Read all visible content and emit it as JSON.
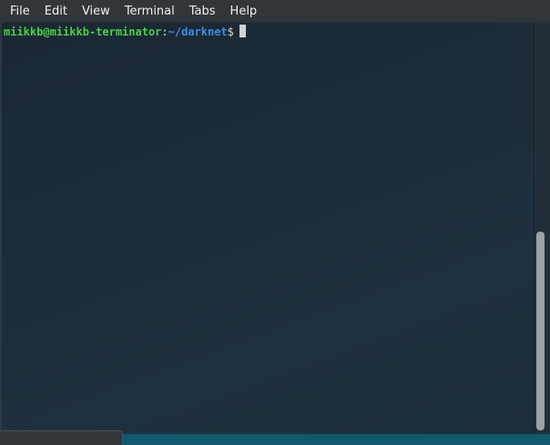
{
  "menubar": {
    "items": [
      {
        "label": "File"
      },
      {
        "label": "Edit"
      },
      {
        "label": "View"
      },
      {
        "label": "Terminal"
      },
      {
        "label": "Tabs"
      },
      {
        "label": "Help"
      }
    ]
  },
  "terminal": {
    "prompt": {
      "user_host": "miikkb@miikkb-terminator",
      "colon": ":",
      "path": "~/darknet",
      "dollar": "$"
    }
  },
  "colors": {
    "background": "#1c2b37",
    "user_host": "#4cd04a",
    "path": "#3d8fe0",
    "menubar": "#31363b"
  }
}
